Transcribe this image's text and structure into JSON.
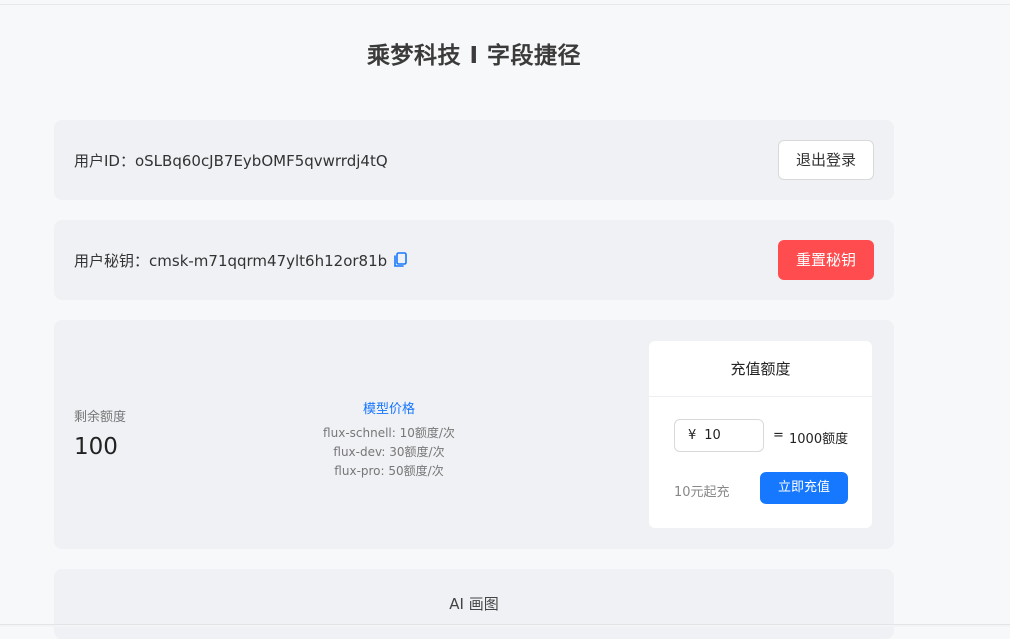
{
  "header": {
    "title": "乘梦科技 I 字段捷径"
  },
  "user": {
    "id_label": "用户ID：",
    "id_value": "oSLBq60cJB7EybOMF5qvwrrdj4tQ",
    "logout_label": "退出登录"
  },
  "key": {
    "label": "用户秘钥：",
    "value": "cmsk-m71qqrm47ylt6h12or81b",
    "reset_label": "重置秘钥"
  },
  "quota": {
    "remaining_label": "剩余额度",
    "remaining_value": "100",
    "price_title": "模型价格",
    "prices": [
      "flux-schnell: 10额度/次",
      "flux-dev: 30额度/次",
      "flux-pro: 50额度/次"
    ]
  },
  "recharge": {
    "title": "充值额度",
    "currency": "¥",
    "amount": "10",
    "equals": "=",
    "credits": "1000额度",
    "min_note": "10元起充",
    "pay_label": "立即充值"
  },
  "draw": {
    "title": "AI 画图"
  },
  "colors": {
    "accent": "#1677ff",
    "danger": "#ff4d4f"
  },
  "icons": {
    "copy": "copy-icon"
  }
}
